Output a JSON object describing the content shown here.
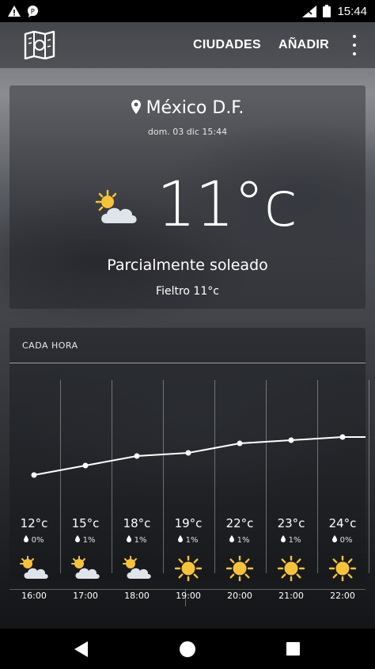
{
  "status_bar": {
    "time": "15:44"
  },
  "app_bar": {
    "cities_label": "CIUDADES",
    "add_label": "AÑADIR"
  },
  "current": {
    "location": "México D.F.",
    "datetime": "dom. 03 dic 15:44",
    "temperature": "11°c",
    "condition": "Parcialmente soleado",
    "feels_like": "Fieltro 11°c",
    "icon": "partly-sunny-icon"
  },
  "hourly": {
    "title": "CADA HORA",
    "items": [
      {
        "temp": "12°c",
        "rain": "0%",
        "time": "16:00",
        "icon": "partly-sunny-icon",
        "temp_value": 12
      },
      {
        "temp": "15°c",
        "rain": "1%",
        "time": "17:00",
        "icon": "partly-sunny-icon",
        "temp_value": 15
      },
      {
        "temp": "18°c",
        "rain": "1%",
        "time": "18:00",
        "icon": "partly-sunny-icon",
        "temp_value": 18
      },
      {
        "temp": "19°c",
        "rain": "1%",
        "time": "19:00",
        "icon": "sun-icon",
        "temp_value": 19
      },
      {
        "temp": "22°c",
        "rain": "1%",
        "time": "20:00",
        "icon": "sun-icon",
        "temp_value": 22
      },
      {
        "temp": "23°c",
        "rain": "1%",
        "time": "21:00",
        "icon": "sun-icon",
        "temp_value": 23
      },
      {
        "temp": "24°c",
        "rain": "0%",
        "time": "22:00",
        "icon": "sun-icon",
        "temp_value": 24
      }
    ]
  },
  "colors": {
    "sun": "#f5c33b",
    "cloud": "#dfe3ea",
    "status_bg": "#000000"
  }
}
